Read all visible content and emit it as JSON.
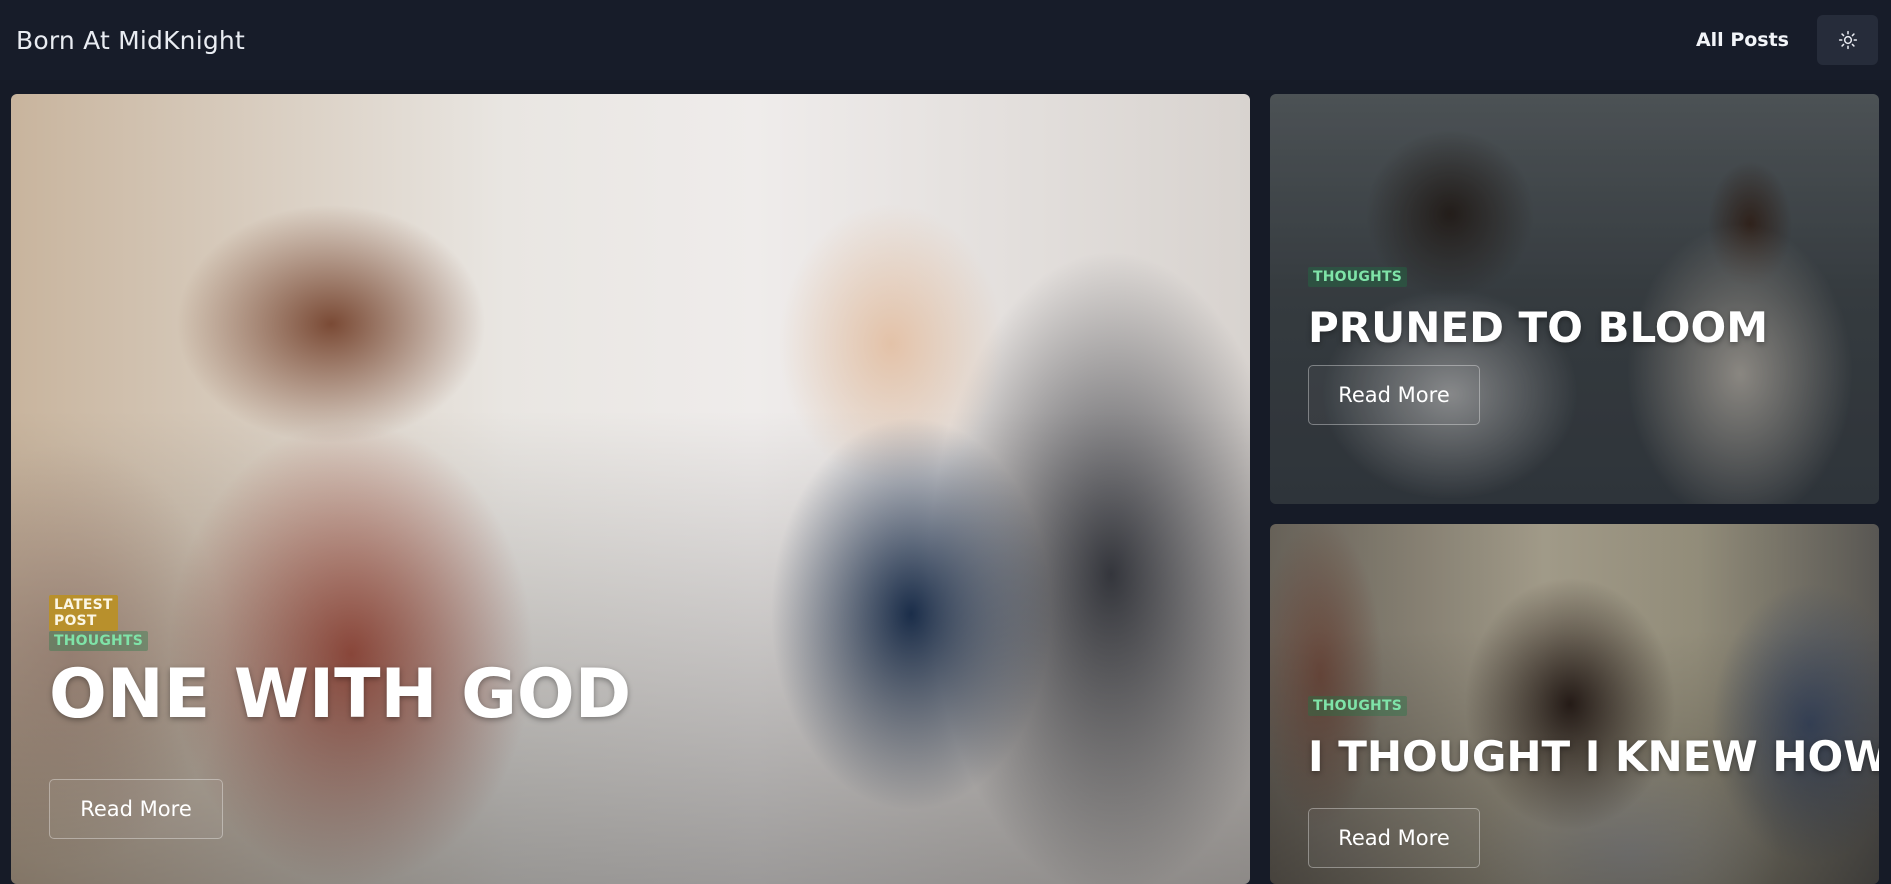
{
  "header": {
    "brand": "Born At MidKnight",
    "nav_all_posts": "All Posts",
    "theme_icon": "sun-icon"
  },
  "hero": {
    "latest_badge": "LATEST POST",
    "category": "THOUGHTS",
    "title": "ONE WITH GOD",
    "button": "Read More"
  },
  "side_posts": [
    {
      "category": "THOUGHTS",
      "title": "PRUNED TO BLOOM",
      "button": "Read More"
    },
    {
      "category": "THOUGHTS",
      "title": "I THOUGHT I KNEW HOW",
      "button": "Read More"
    }
  ],
  "colors": {
    "background": "#161b27",
    "latest_badge": "#b8902c",
    "category_text": "#7fe3a8"
  }
}
